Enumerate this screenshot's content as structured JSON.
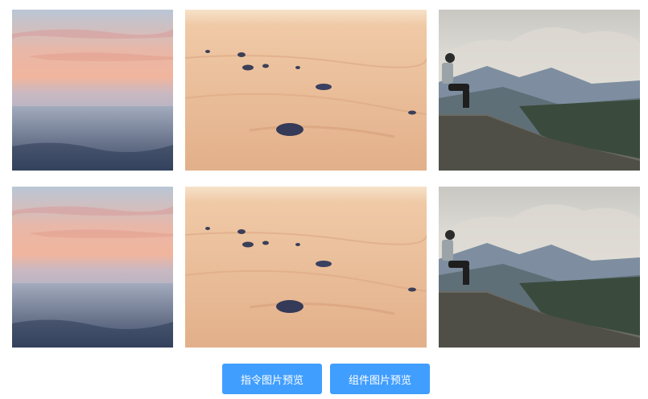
{
  "gallery": {
    "images": [
      {
        "name": "sea-fog-sunset",
        "row": 1
      },
      {
        "name": "sand-pebbles",
        "row": 1
      },
      {
        "name": "man-on-cliff",
        "row": 1
      },
      {
        "name": "sea-fog-sunset",
        "row": 2
      },
      {
        "name": "sand-pebbles",
        "row": 2
      },
      {
        "name": "man-on-cliff",
        "row": 2
      }
    ]
  },
  "actions": {
    "directive_preview_label": "指令图片预览",
    "component_preview_label": "组件图片预览",
    "accent_color": "#409eff"
  }
}
